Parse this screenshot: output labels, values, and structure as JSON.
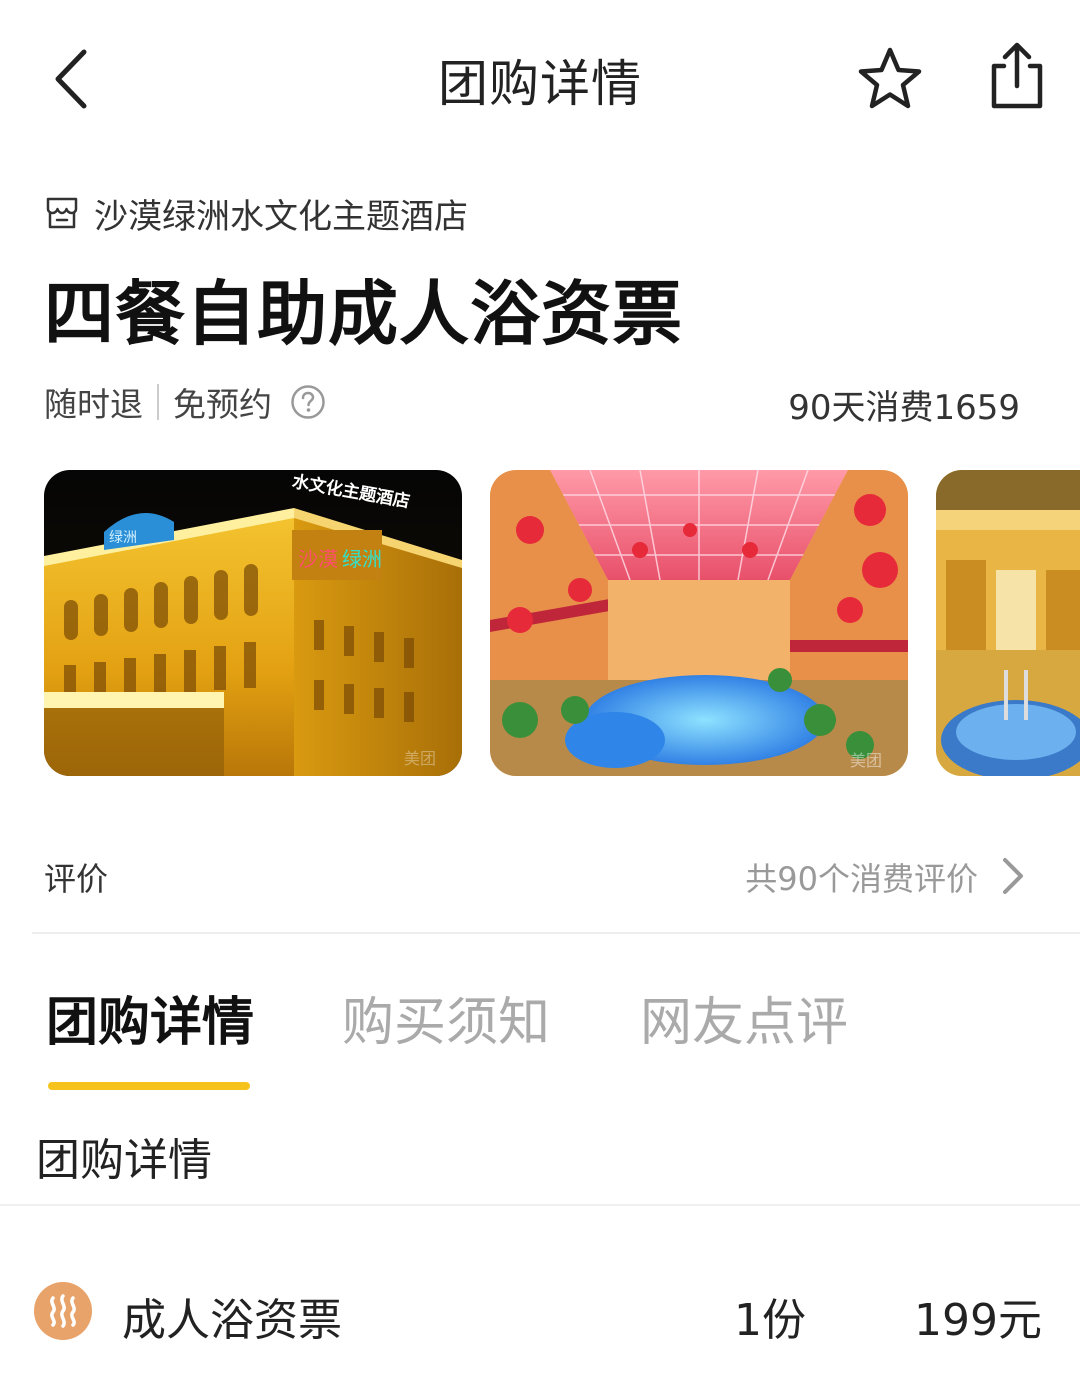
{
  "nav": {
    "title": "团购详情",
    "back_icon": "chevron-left-icon",
    "favorite_icon": "star-icon",
    "share_icon": "share-icon"
  },
  "shop": {
    "icon": "store-icon",
    "name": "沙漠绿洲水文化主题酒店"
  },
  "deal": {
    "title": "四餐自助成人浴资票",
    "tags": [
      "随时退",
      "免预约"
    ],
    "help_icon": "question-circle-icon",
    "sold_text": "90天消费1659"
  },
  "gallery": {
    "photos": [
      {
        "name": "hotel-exterior-night",
        "sign_text": "水文化主题酒店",
        "logo_text": "沙漠绿洲"
      },
      {
        "name": "indoor-water-park-atrium",
        "watermark": "美团"
      },
      {
        "name": "spa-pool-room"
      }
    ]
  },
  "reviews": {
    "label": "评价",
    "count_text": "共90个消费评价"
  },
  "tabs": [
    {
      "label": "团购详情",
      "active": true
    },
    {
      "label": "购买须知",
      "active": false
    },
    {
      "label": "网友点评",
      "active": false
    }
  ],
  "section": {
    "title": "团购详情"
  },
  "items": [
    {
      "icon": "steam-icon",
      "name": "成人浴资票",
      "qty": "1份",
      "price": "199元"
    }
  ],
  "colors": {
    "accent_yellow": "#f6c21c",
    "steam_icon_bg": "#e8a36a",
    "muted_text": "#999999"
  }
}
